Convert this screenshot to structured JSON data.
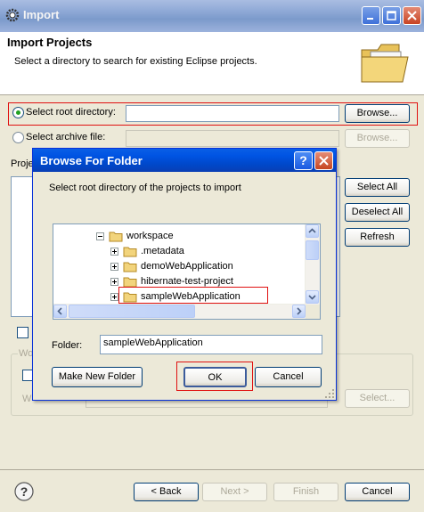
{
  "window": {
    "title": "Import"
  },
  "header": {
    "title": "Import Projects",
    "description": "Select a directory to search for existing Eclipse projects."
  },
  "source": {
    "root_label": "Select root directory:",
    "root_value": "",
    "archive_label": "Select archive file:",
    "archive_value": "",
    "browse_label": "Browse...",
    "browse_archive_label": "Browse...",
    "selected_option": "root"
  },
  "projects": {
    "label_partial": "Proje",
    "select_all": "Select All",
    "deselect_all": "Deselect All",
    "refresh": "Refresh"
  },
  "working_sets": {
    "group_label_partial": "Wo",
    "select_label": "Select...",
    "field_label_partial": "W"
  },
  "footer": {
    "back": "< Back",
    "next": "Next >",
    "finish": "Finish",
    "cancel": "Cancel"
  },
  "dialog": {
    "title": "Browse For Folder",
    "help_glyph": "?",
    "description": "Select root directory of the projects to import",
    "tree": [
      {
        "label": "workspace",
        "level": 0,
        "expanded": true,
        "selected": false
      },
      {
        "label": ".metadata",
        "level": 1,
        "expanded": false,
        "selected": false
      },
      {
        "label": "demoWebApplication",
        "level": 1,
        "expanded": false,
        "selected": false
      },
      {
        "label": "hibernate-test-project",
        "level": 1,
        "expanded": false,
        "selected": false
      },
      {
        "label": "sampleWebApplication",
        "level": 1,
        "expanded": false,
        "selected": true
      }
    ],
    "folder_label": "Folder:",
    "folder_value": "sampleWebApplication",
    "make_new_folder": "Make New Folder",
    "ok": "OK",
    "cancel": "Cancel"
  },
  "colors": {
    "titlebar": "#7c9acb",
    "dialog_titlebar": "#0054e3",
    "highlight_box": "#e01010",
    "window_bg": "#ece9d8"
  }
}
